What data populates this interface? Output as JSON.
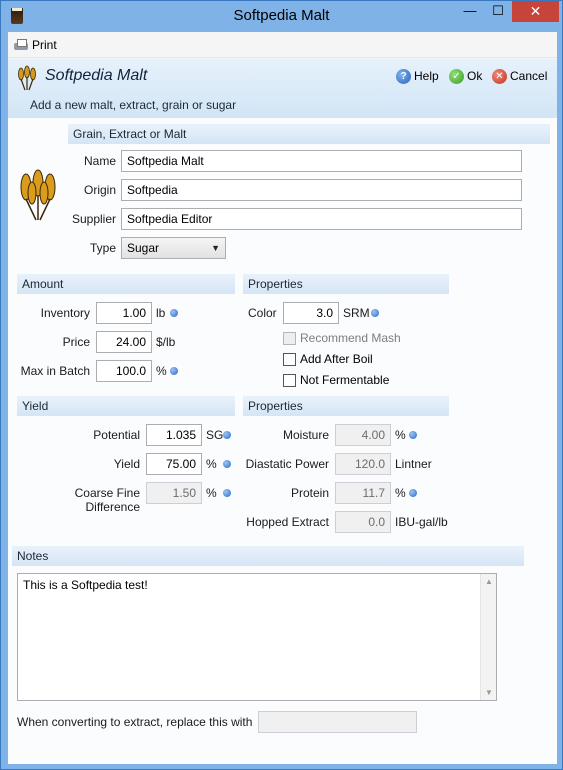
{
  "window": {
    "title": "Softpedia Malt",
    "min": "—",
    "max": "☐",
    "close": "✕"
  },
  "toolbar": {
    "print_label": "Print"
  },
  "header": {
    "title": "Softpedia Malt",
    "subtitle": "Add a new malt, extract, grain or sugar",
    "help_label": "Help",
    "ok_label": "Ok",
    "cancel_label": "Cancel"
  },
  "grain": {
    "section_title": "Grain, Extract or Malt",
    "name_label": "Name",
    "name_value": "Softpedia Malt",
    "origin_label": "Origin",
    "origin_value": "Softpedia",
    "supplier_label": "Supplier",
    "supplier_value": "Softpedia Editor",
    "type_label": "Type",
    "type_value": "Sugar"
  },
  "amount": {
    "section_title": "Amount",
    "inventory_label": "Inventory",
    "inventory_value": "1.00",
    "inventory_unit": "lb",
    "price_label": "Price",
    "price_value": "24.00",
    "price_unit": "$/lb",
    "max_label": "Max in Batch",
    "max_value": "100.0",
    "max_unit": "%"
  },
  "properties1": {
    "section_title": "Properties",
    "color_label": "Color",
    "color_value": "3.0",
    "color_unit": "SRM",
    "recommend_mash": "Recommend Mash",
    "add_after_boil": "Add After Boil",
    "not_fermentable": "Not Fermentable"
  },
  "yield": {
    "section_title": "Yield",
    "potential_label": "Potential",
    "potential_value": "1.035",
    "potential_unit": "SG",
    "yield_label": "Yield",
    "yield_value": "75.00",
    "yield_unit": "%",
    "cfd_label": "Coarse Fine Difference",
    "cfd_value": "1.50",
    "cfd_unit": "%"
  },
  "properties2": {
    "section_title": "Properties",
    "moisture_label": "Moisture",
    "moisture_value": "4.00",
    "moisture_unit": "%",
    "diastatic_label": "Diastatic Power",
    "diastatic_value": "120.0",
    "diastatic_unit": "Lintner",
    "protein_label": "Protein",
    "protein_value": "11.7",
    "protein_unit": "%",
    "hopped_label": "Hopped Extract",
    "hopped_value": "0.0",
    "hopped_unit": "IBU-gal/lb"
  },
  "notes": {
    "section_title": "Notes",
    "text": "This is a Softpedia test!",
    "replace_label": "When converting to extract, replace this with",
    "replace_value": ""
  }
}
